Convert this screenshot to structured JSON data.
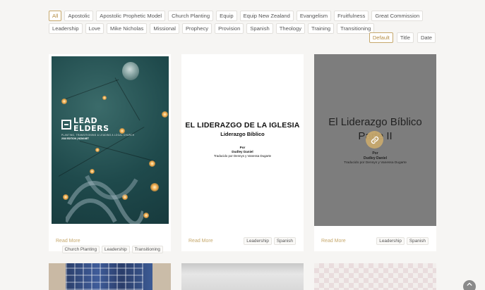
{
  "filters": [
    "All",
    "Apostolic",
    "Apostolic Prophetic Model",
    "Church Planting",
    "Equip",
    "Equip New Zealand",
    "Evangelism",
    "Fruitfulness",
    "Great Commission",
    "Leadership",
    "Love",
    "Mike Nicholas",
    "Missional",
    "Prophecy",
    "Provision",
    "Spanish",
    "Theology",
    "Training",
    "Transitioning"
  ],
  "active_filter": "All",
  "sort": {
    "default": "Default",
    "title": "Title",
    "date": "Date",
    "active": "Default"
  },
  "cards": [
    {
      "cover": {
        "title": "LEAD ELDERS",
        "title_line1": "LEAD",
        "title_line2": "ELDERS",
        "subtitle": "PLANTING, TRANSITIONING & LEADING A LOCAL CHURCH",
        "edition": "2018 EDITION | NCMI.NET",
        "mark": "NCMI"
      },
      "read_more": "Read More",
      "tags": [
        "Church Planting",
        "Leadership",
        "Transitioning"
      ]
    },
    {
      "cover": {
        "title": "EL LIDERAZGO DE LA IGLESIA",
        "subtitle": "Liderazgo Bíblico",
        "por": "Por",
        "author": "Dudley Daniel",
        "translation": "Traducido por Dennys y Vanessa Dugarte"
      },
      "read_more": "Read More",
      "tags": [
        "Leadership",
        "Spanish"
      ]
    },
    {
      "cover": {
        "title_line1": "El Liderazgo Bíblico",
        "title_line2": "Parte II",
        "por": "Por",
        "author": "Dudley Daniel",
        "translation": "Traducido por Dennys y Vanessa Dugarte"
      },
      "read_more": "Read More",
      "tags": [
        "Leadership",
        "Spanish"
      ]
    }
  ],
  "colors": {
    "accent": "#c6a86c",
    "background": "#f6f5f3"
  },
  "icons": {
    "card3_hover": "link-icon",
    "scroll_top": "chevron-up-icon"
  }
}
